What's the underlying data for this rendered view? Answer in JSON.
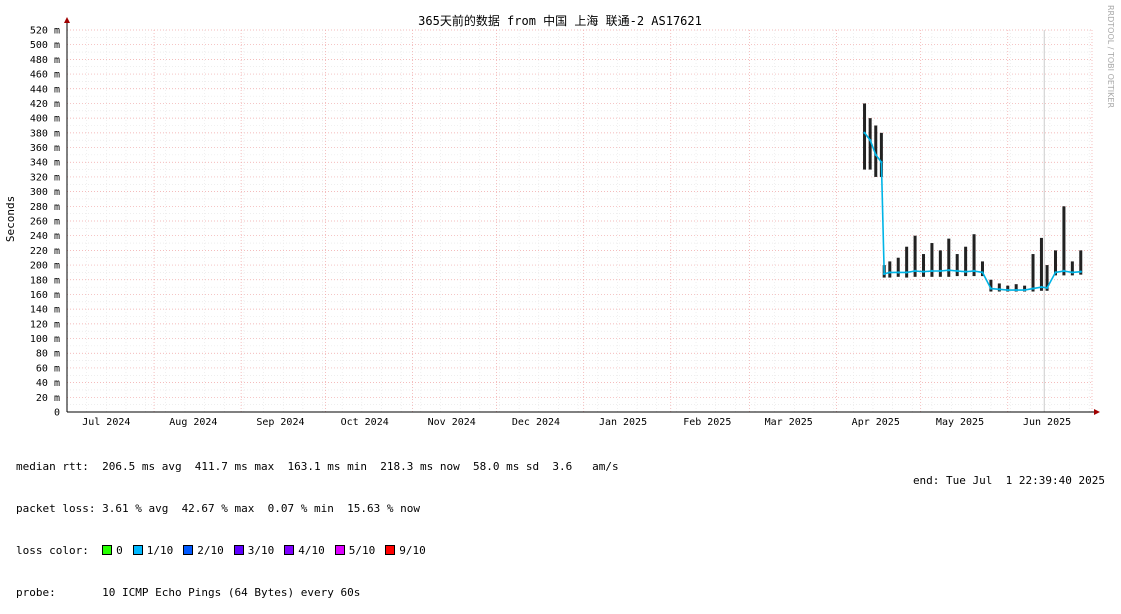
{
  "chart_data": {
    "type": "line",
    "title": "365天前的数据 from 中国 上海 联通-2 AS17621",
    "ylabel": "Seconds",
    "ylim": [
      0,
      0.52
    ],
    "y_ticks": [
      {
        "v": 0,
        "label": "0"
      },
      {
        "v": 0.02,
        "label": "20 m"
      },
      {
        "v": 0.04,
        "label": "40 m"
      },
      {
        "v": 0.06,
        "label": "60 m"
      },
      {
        "v": 0.08,
        "label": "80 m"
      },
      {
        "v": 0.1,
        "label": "100 m"
      },
      {
        "v": 0.12,
        "label": "120 m"
      },
      {
        "v": 0.14,
        "label": "140 m"
      },
      {
        "v": 0.16,
        "label": "160 m"
      },
      {
        "v": 0.18,
        "label": "180 m"
      },
      {
        "v": 0.2,
        "label": "200 m"
      },
      {
        "v": 0.22,
        "label": "220 m"
      },
      {
        "v": 0.24,
        "label": "240 m"
      },
      {
        "v": 0.26,
        "label": "260 m"
      },
      {
        "v": 0.28,
        "label": "280 m"
      },
      {
        "v": 0.3,
        "label": "300 m"
      },
      {
        "v": 0.32,
        "label": "320 m"
      },
      {
        "v": 0.34,
        "label": "340 m"
      },
      {
        "v": 0.36,
        "label": "360 m"
      },
      {
        "v": 0.38,
        "label": "380 m"
      },
      {
        "v": 0.4,
        "label": "400 m"
      },
      {
        "v": 0.42,
        "label": "420 m"
      },
      {
        "v": 0.44,
        "label": "440 m"
      },
      {
        "v": 0.46,
        "label": "460 m"
      },
      {
        "v": 0.48,
        "label": "480 m"
      },
      {
        "v": 0.5,
        "label": "500 m"
      },
      {
        "v": 0.52,
        "label": "520 m"
      }
    ],
    "x_range": [
      "2024-07-01",
      "2025-07-01"
    ],
    "x_month_boundaries": [
      "2024-07-01",
      "2024-08-01",
      "2024-09-01",
      "2024-10-01",
      "2024-11-01",
      "2024-12-01",
      "2025-01-01",
      "2025-02-01",
      "2025-03-01",
      "2025-04-01",
      "2025-05-01",
      "2025-06-01",
      "2025-07-01"
    ],
    "x_labels": [
      {
        "date": "2024-07-15",
        "label": "Jul 2024"
      },
      {
        "date": "2024-08-15",
        "label": "Aug 2024"
      },
      {
        "date": "2024-09-15",
        "label": "Sep 2024"
      },
      {
        "date": "2024-10-15",
        "label": "Oct 2024"
      },
      {
        "date": "2024-11-15",
        "label": "Nov 2024"
      },
      {
        "date": "2024-12-15",
        "label": "Dec 2024"
      },
      {
        "date": "2025-01-15",
        "label": "Jan 2025"
      },
      {
        "date": "2025-02-14",
        "label": "Feb 2025"
      },
      {
        "date": "2025-03-15",
        "label": "Mar 2025"
      },
      {
        "date": "2025-04-15",
        "label": "Apr 2025"
      },
      {
        "date": "2025-05-15",
        "label": "May 2025"
      },
      {
        "date": "2025-06-15",
        "label": "Jun 2025"
      }
    ],
    "grid": true,
    "series": [
      {
        "color": "#00b4e6",
        "points": [
          {
            "date": "2025-04-11",
            "min": 0.33,
            "max": 0.42,
            "median": 0.38
          },
          {
            "date": "2025-04-13",
            "min": 0.33,
            "max": 0.4,
            "median": 0.37
          },
          {
            "date": "2025-04-15",
            "min": 0.32,
            "max": 0.39,
            "median": 0.35
          },
          {
            "date": "2025-04-17",
            "min": 0.32,
            "max": 0.38,
            "median": 0.34
          },
          {
            "date": "2025-04-18",
            "min": 0.183,
            "max": 0.2,
            "median": 0.188
          },
          {
            "date": "2025-04-20",
            "min": 0.183,
            "max": 0.205,
            "median": 0.19
          },
          {
            "date": "2025-04-23",
            "min": 0.184,
            "max": 0.21,
            "median": 0.19
          },
          {
            "date": "2025-04-26",
            "min": 0.183,
            "max": 0.225,
            "median": 0.19
          },
          {
            "date": "2025-04-29",
            "min": 0.184,
            "max": 0.24,
            "median": 0.192
          },
          {
            "date": "2025-05-02",
            "min": 0.184,
            "max": 0.215,
            "median": 0.191
          },
          {
            "date": "2025-05-05",
            "min": 0.184,
            "max": 0.23,
            "median": 0.192
          },
          {
            "date": "2025-05-08",
            "min": 0.184,
            "max": 0.22,
            "median": 0.192
          },
          {
            "date": "2025-05-11",
            "min": 0.184,
            "max": 0.236,
            "median": 0.193
          },
          {
            "date": "2025-05-14",
            "min": 0.185,
            "max": 0.215,
            "median": 0.192
          },
          {
            "date": "2025-05-17",
            "min": 0.185,
            "max": 0.225,
            "median": 0.191
          },
          {
            "date": "2025-05-20",
            "min": 0.185,
            "max": 0.242,
            "median": 0.192
          },
          {
            "date": "2025-05-23",
            "min": 0.185,
            "max": 0.205,
            "median": 0.19
          },
          {
            "date": "2025-05-26",
            "min": 0.164,
            "max": 0.18,
            "median": 0.168
          },
          {
            "date": "2025-05-29",
            "min": 0.164,
            "max": 0.175,
            "median": 0.167
          },
          {
            "date": "2025-06-01",
            "min": 0.164,
            "max": 0.172,
            "median": 0.166
          },
          {
            "date": "2025-06-04",
            "min": 0.164,
            "max": 0.174,
            "median": 0.166
          },
          {
            "date": "2025-06-07",
            "min": 0.164,
            "max": 0.172,
            "median": 0.166
          },
          {
            "date": "2025-06-10",
            "min": 0.164,
            "max": 0.215,
            "median": 0.168
          },
          {
            "date": "2025-06-13",
            "min": 0.165,
            "max": 0.237,
            "median": 0.17
          },
          {
            "date": "2025-06-15",
            "min": 0.165,
            "max": 0.2,
            "median": 0.169
          },
          {
            "date": "2025-06-18",
            "min": 0.186,
            "max": 0.22,
            "median": 0.19
          },
          {
            "date": "2025-06-21",
            "min": 0.186,
            "max": 0.28,
            "median": 0.192
          },
          {
            "date": "2025-06-24",
            "min": 0.186,
            "max": 0.205,
            "median": 0.19
          },
          {
            "date": "2025-06-27",
            "min": 0.187,
            "max": 0.22,
            "median": 0.191
          }
        ]
      }
    ],
    "spike_marker": {
      "date": "2025-06-14",
      "color": "#cccccc"
    },
    "side_label": "RRDTOOL / TOBI OETIKER"
  },
  "stats": {
    "median_rtt": "median rtt:  206.5 ms avg  411.7 ms max  163.1 ms min  218.3 ms now  58.0 ms sd  3.6   am/s",
    "packet_loss": "packet loss: 3.61 % avg  42.67 % max  0.07 % min  15.63 % now",
    "loss_color_label": "loss color:",
    "legend": [
      {
        "label": "0",
        "color": "#26ff00"
      },
      {
        "label": "1/10",
        "color": "#00b8ff"
      },
      {
        "label": "2/10",
        "color": "#0059ff"
      },
      {
        "label": "3/10",
        "color": "#5e00ff"
      },
      {
        "label": "4/10",
        "color": "#7e00ff"
      },
      {
        "label": "5/10",
        "color": "#dd00ff"
      },
      {
        "label": "9/10",
        "color": "#ff0000"
      }
    ],
    "probe": "probe:       10 ICMP Echo Pings (64 Bytes) every 60s",
    "end": "end: Tue Jul  1 22:39:40 2025"
  }
}
